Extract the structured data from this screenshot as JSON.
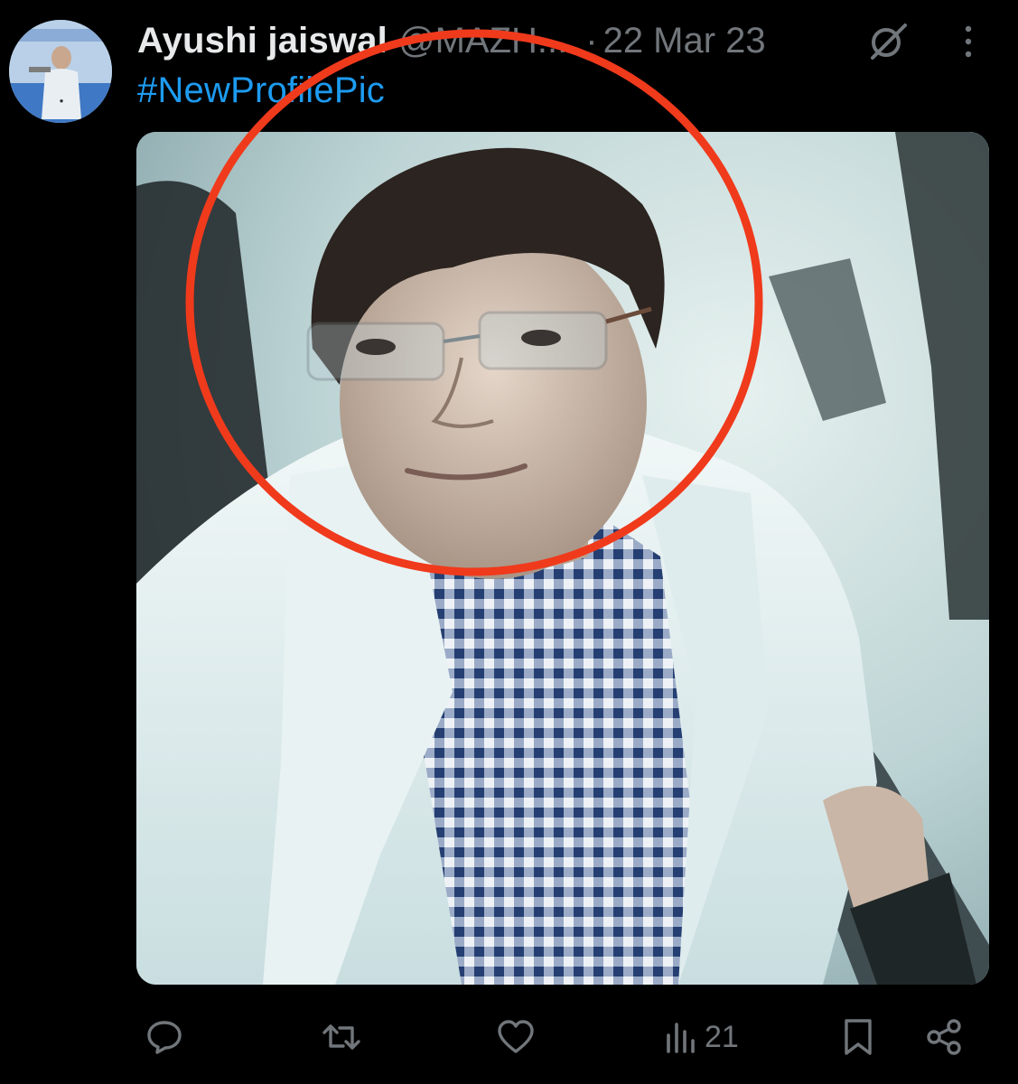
{
  "tweet": {
    "display_name": "Ayushi jaiswal",
    "handle": "@MAZH...",
    "separator": "·",
    "timestamp": "22 Mar 23",
    "hashtag": "#NewProfilePic"
  },
  "media": {
    "annotation_color": "#f03a1c"
  },
  "actions": {
    "reply": {
      "icon": "reply-icon"
    },
    "retweet": {
      "icon": "retweet-icon"
    },
    "like": {
      "icon": "heart-icon"
    },
    "views": {
      "icon": "views-icon",
      "count": "21"
    },
    "bookmark": {
      "icon": "bookmark-icon"
    },
    "share": {
      "icon": "share-icon"
    }
  },
  "colors": {
    "background": "#000000",
    "primary_text": "#e7e9ea",
    "secondary_text": "#71767b",
    "link": "#1d9bf0"
  }
}
